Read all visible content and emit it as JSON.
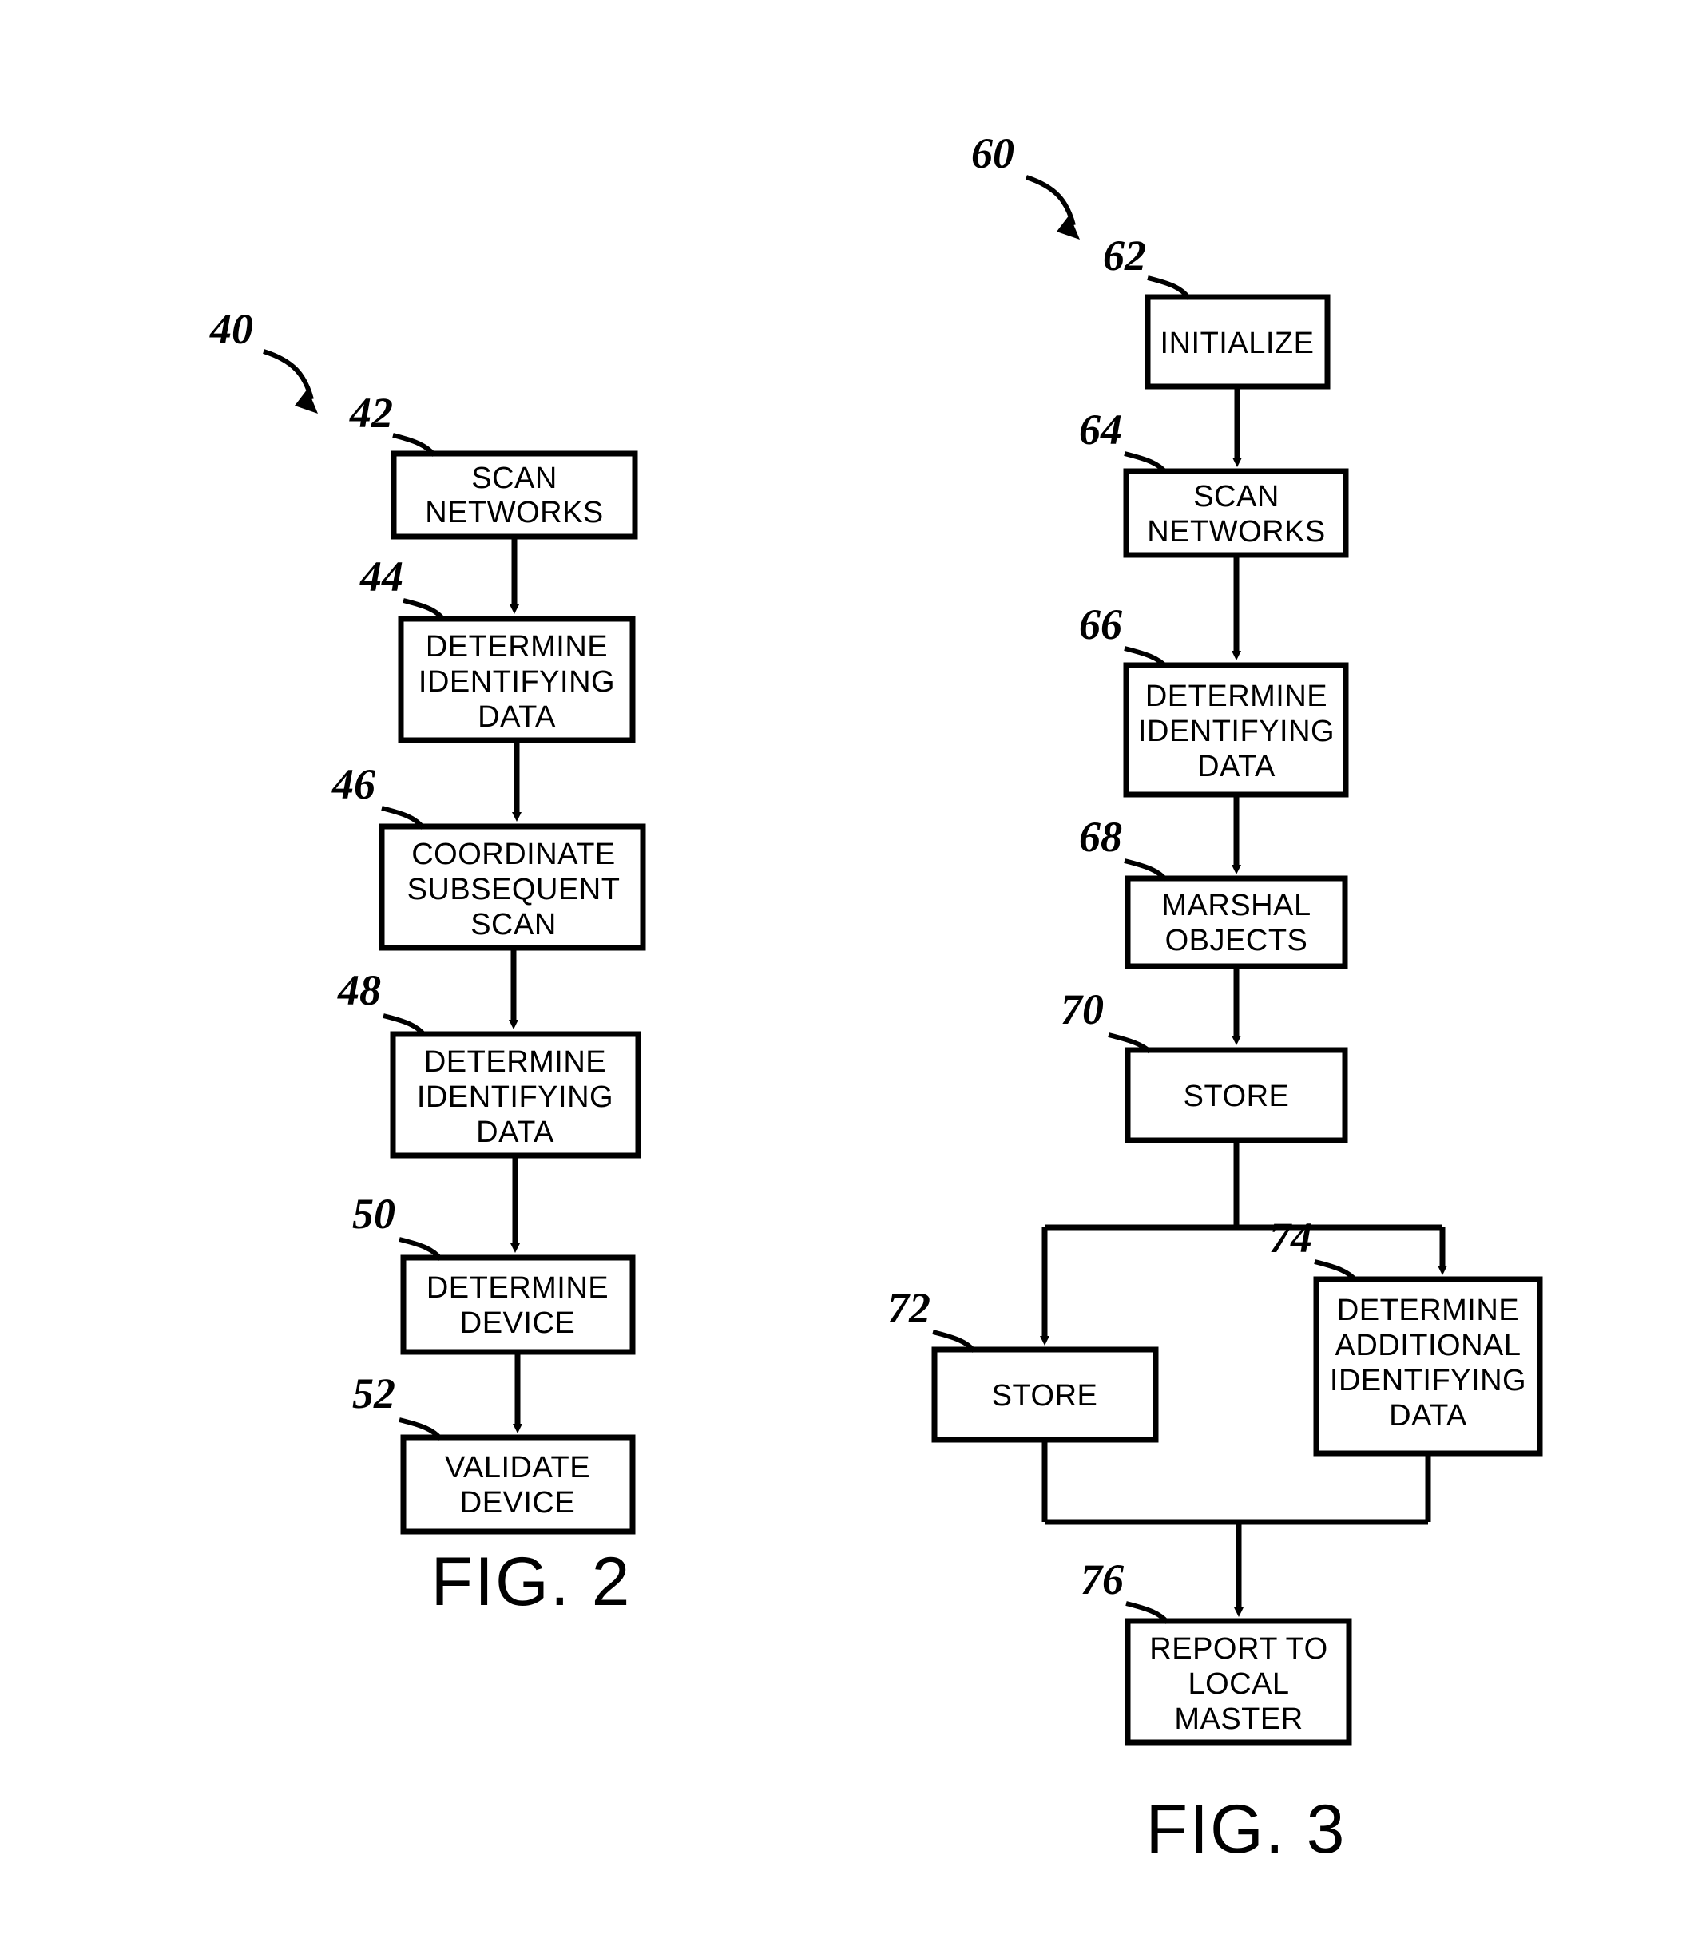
{
  "figures": [
    {
      "id": "fig2",
      "caption": "FIG. 2",
      "process_ref": "40",
      "steps": [
        {
          "ref": "42",
          "lines": [
            "SCAN",
            "NETWORKS"
          ]
        },
        {
          "ref": "44",
          "lines": [
            "DETERMINE",
            "IDENTIFYING",
            "DATA"
          ]
        },
        {
          "ref": "46",
          "lines": [
            "COORDINATE",
            "SUBSEQUENT",
            "SCAN"
          ]
        },
        {
          "ref": "48",
          "lines": [
            "DETERMINE",
            "IDENTIFYING",
            "DATA"
          ]
        },
        {
          "ref": "50",
          "lines": [
            "DETERMINE",
            "DEVICE"
          ]
        },
        {
          "ref": "52",
          "lines": [
            "VALIDATE",
            "DEVICE"
          ]
        }
      ]
    },
    {
      "id": "fig3",
      "caption": "FIG. 3",
      "process_ref": "60",
      "steps": [
        {
          "ref": "62",
          "lines": [
            "INITIALIZE"
          ]
        },
        {
          "ref": "64",
          "lines": [
            "SCAN",
            "NETWORKS"
          ]
        },
        {
          "ref": "66",
          "lines": [
            "DETERMINE",
            "IDENTIFYING",
            "DATA"
          ]
        },
        {
          "ref": "68",
          "lines": [
            "MARSHAL",
            "OBJECTS"
          ]
        },
        {
          "ref": "70",
          "lines": [
            "STORE"
          ]
        },
        {
          "ref": "72",
          "lines": [
            "STORE"
          ]
        },
        {
          "ref": "74",
          "lines": [
            "DETERMINE",
            "ADDITIONAL",
            "IDENTIFYING",
            "DATA"
          ]
        },
        {
          "ref": "76",
          "lines": [
            "REPORT TO",
            "LOCAL",
            "MASTER"
          ]
        }
      ]
    }
  ],
  "colors": {
    "ink": "#000000",
    "paper": "#ffffff"
  }
}
